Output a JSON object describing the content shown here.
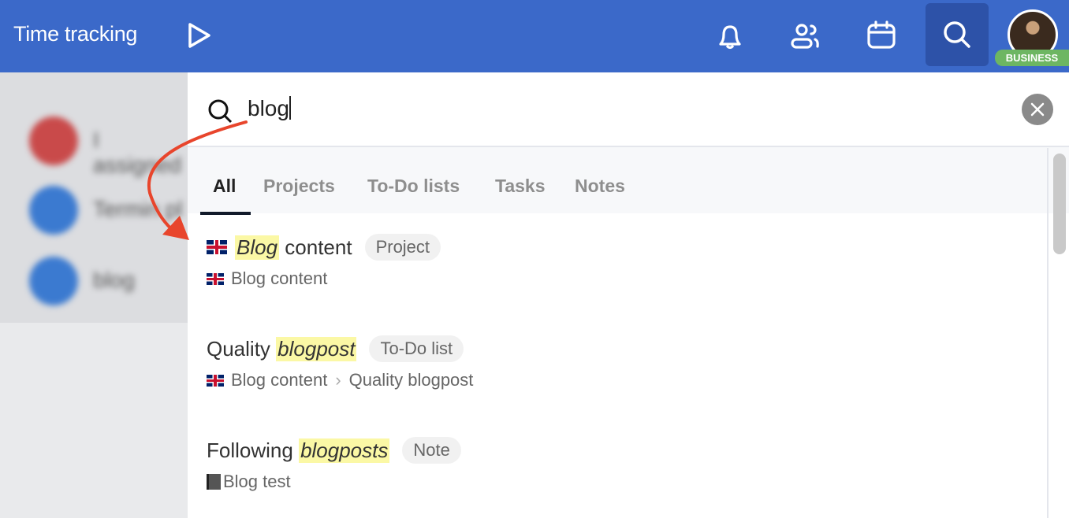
{
  "header": {
    "title": "Time tracking",
    "badge": "BUSINESS",
    "icons": [
      "play-icon",
      "bell-icon",
      "users-icon",
      "calendar-icon",
      "search-icon",
      "avatar"
    ]
  },
  "background_list": [
    {
      "label": "I assigned",
      "color": "#c94a4a"
    },
    {
      "label": "Termin pl",
      "color": "#3b7ad0"
    },
    {
      "label": "blog",
      "color": "#3b7ad0"
    }
  ],
  "search": {
    "query": "blog"
  },
  "tabs": [
    "All",
    "Projects",
    "To-Do lists",
    "Tasks",
    "Notes"
  ],
  "active_tab": "All",
  "results": [
    {
      "match": "Blog",
      "rest": " content",
      "prefix": "",
      "type": "Project",
      "path": [
        "Blog content"
      ],
      "path_icon": "uk-flag"
    },
    {
      "prefix": "Quality ",
      "match": "blogpost",
      "rest": "",
      "type": "To-Do list",
      "path": [
        "Blog content",
        "Quality blogpost"
      ],
      "path_icon": "uk-flag"
    },
    {
      "prefix": "Following ",
      "match": "blogposts",
      "rest": "",
      "type": "Note",
      "path": [
        "Blog test"
      ],
      "path_icon": "notebook"
    }
  ],
  "colors": {
    "header": "#3b69c9",
    "highlight": "#fbf8a5",
    "badge": "#6db662",
    "annotation_arrow": "#e8452c"
  }
}
